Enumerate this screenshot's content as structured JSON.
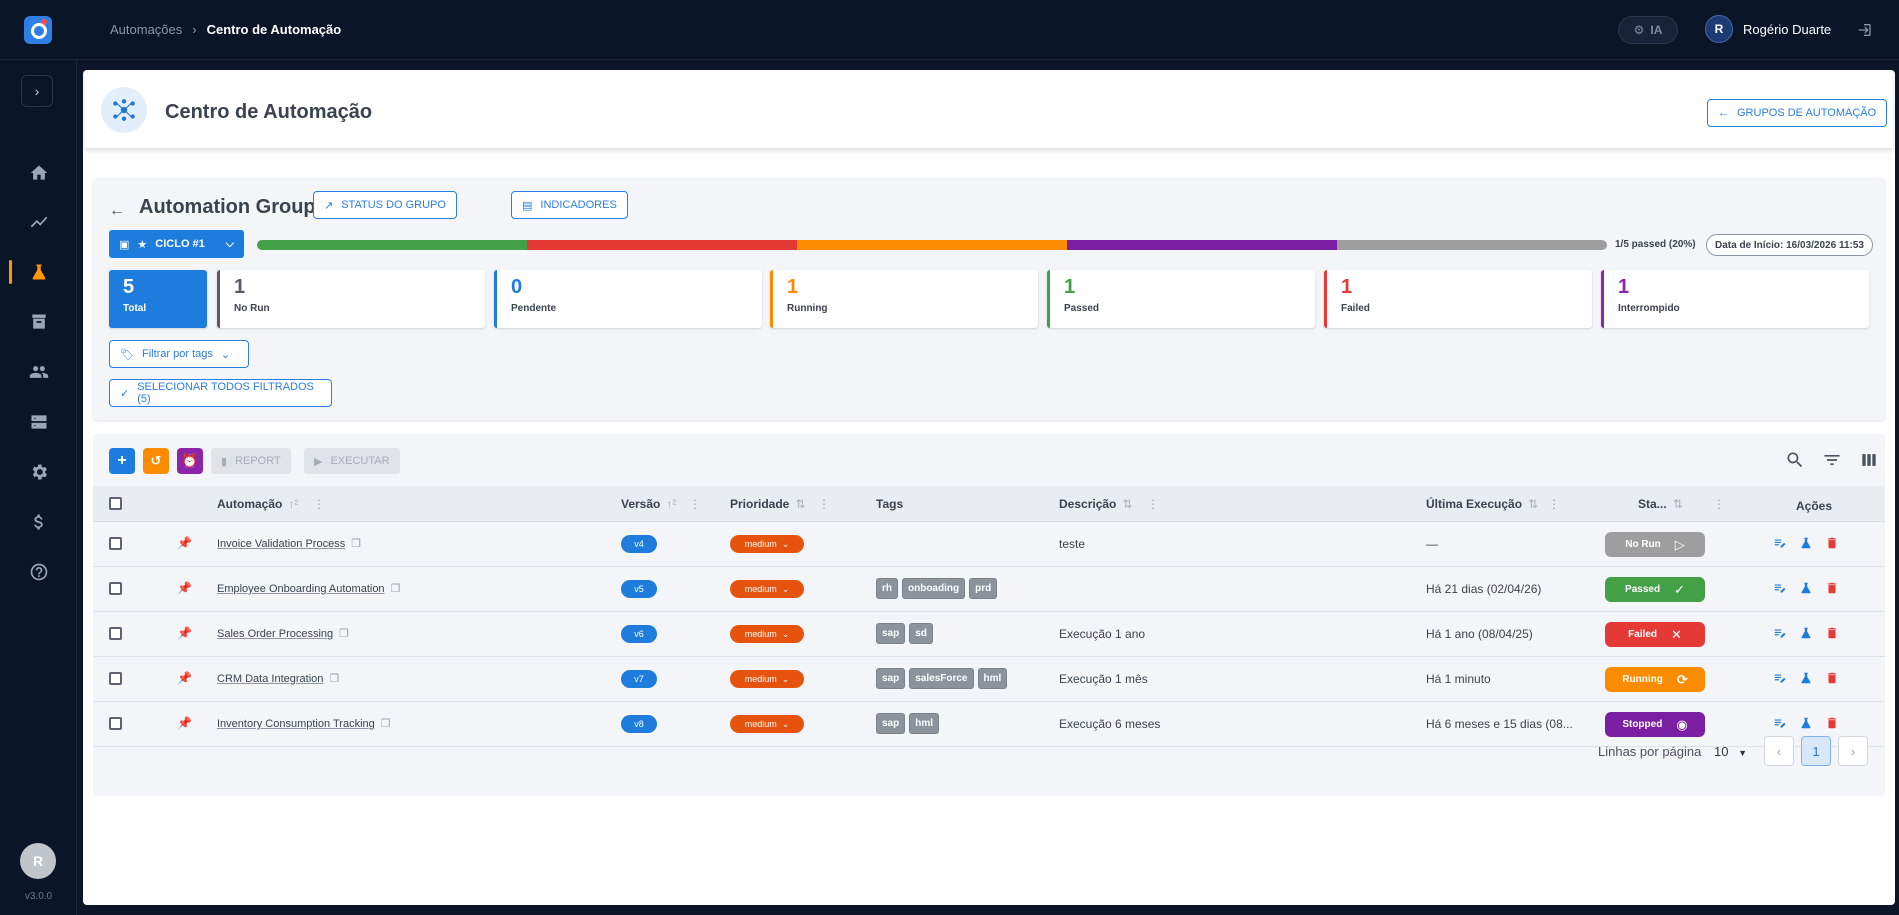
{
  "topbar": {
    "breadcrumb_parent": "Automações",
    "breadcrumb_sep": "›",
    "breadcrumb_current": "Centro de Automação",
    "ia_label": "IA",
    "user_initial": "R",
    "user_name": "Rogério Duarte"
  },
  "sidebar": {
    "toggle": "›",
    "items": [
      "home-icon",
      "chart-icon",
      "flask-icon",
      "archive-icon",
      "people-icon",
      "server-icon",
      "settings-icon",
      "dollar-icon",
      "help-icon"
    ],
    "active_item": "flask-icon",
    "avatar_initial": "R",
    "version": "v3.0.0"
  },
  "header": {
    "title": "Centro de Automação",
    "groups_button": "GRUPOS DE AUTOMAÇÃO"
  },
  "group": {
    "title": "Automation Group #1",
    "status_button": "STATUS DO GRUPO",
    "indicators_button": "INDICADORES",
    "cycle_label": "CICLO #1",
    "passed_text": "1/5 passed (20%)",
    "start_date": "Data de Início: 16/03/2026 11:53",
    "progress_segments": [
      {
        "name": "passed",
        "fraction": 0.2,
        "color": "#43a047"
      },
      {
        "name": "failed",
        "fraction": 0.2,
        "color": "#e53935"
      },
      {
        "name": "running",
        "fraction": 0.2,
        "color": "#fb8c00"
      },
      {
        "name": "interrupted",
        "fraction": 0.2,
        "color": "#7b1fa2"
      },
      {
        "name": "no-run",
        "fraction": 0.2,
        "color": "#9e9e9e"
      }
    ],
    "stats": {
      "total": {
        "value": "5",
        "label": "Total"
      },
      "norun": {
        "value": "1",
        "label": "No Run",
        "color": "#555c66"
      },
      "pending": {
        "value": "0",
        "label": "Pendente",
        "color": "#1e7ddc"
      },
      "running": {
        "value": "1",
        "label": "Running",
        "color": "#fb8c00"
      },
      "passed": {
        "value": "1",
        "label": "Passed",
        "color": "#43a047"
      },
      "failed": {
        "value": "1",
        "label": "Failed",
        "color": "#e53935"
      },
      "interrupted": {
        "value": "1",
        "label": "Interrompido",
        "color": "#8e24aa"
      }
    },
    "tag_filter": "Filtrar por tags",
    "select_all": "SELECIONAR TODOS FILTRADOS (5)"
  },
  "toolbar": {
    "report": "REPORT",
    "execute": "EXECUTAR"
  },
  "table": {
    "headers": {
      "automation": "Automação",
      "version": "Versão",
      "priority": "Prioridade",
      "tags": "Tags",
      "description": "Descrição",
      "last_run": "Última Execução",
      "status": "Sta...",
      "actions": "Ações"
    },
    "rows": [
      {
        "name": "Invoice Validation Process",
        "version": "v4",
        "priority": "medium",
        "tags": [],
        "description": "teste",
        "last_run": "—",
        "status": "No Run",
        "status_color": "#9e9e9e"
      },
      {
        "name": "Employee Onboarding Automation",
        "version": "v5",
        "priority": "medium",
        "tags": [
          "rh",
          "onboading",
          "prd"
        ],
        "description": "",
        "last_run": "Há 21 dias (02/04/26)",
        "status": "Passed",
        "status_color": "#43a047"
      },
      {
        "name": "Sales Order Processing",
        "version": "v6",
        "priority": "medium",
        "tags": [
          "sap",
          "sd"
        ],
        "description": "Execução 1 ano",
        "last_run": "Há 1 ano (08/04/25)",
        "status": "Failed",
        "status_color": "#e53935"
      },
      {
        "name": "CRM Data Integration",
        "version": "v7",
        "priority": "medium",
        "tags": [
          "sap",
          "salesForce",
          "hml"
        ],
        "description": "Execução 1 mês",
        "last_run": "Há 1 minuto",
        "status": "Running",
        "status_color": "#fb8c00"
      },
      {
        "name": "Inventory Consumption Tracking",
        "version": "v8",
        "priority": "medium",
        "tags": [
          "sap",
          "hml"
        ],
        "description": "Execução 6 meses",
        "last_run": "Há 6 meses e 15 dias (08...",
        "status": "Stopped",
        "status_color": "#7b1fa2"
      }
    ]
  },
  "pagination": {
    "rows_per_page_label": "Linhas por página",
    "rows_per_page": "10",
    "current_page": "1"
  }
}
